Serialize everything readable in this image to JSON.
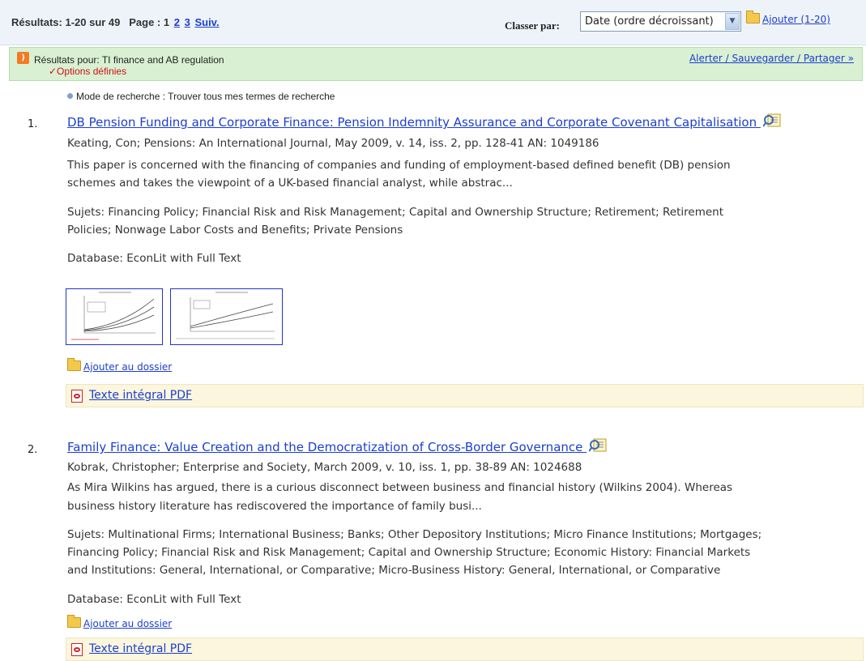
{
  "header": {
    "results_summary": "Résultats: 1-20 sur 49",
    "page_label": "Page : 1",
    "page_links": [
      "2",
      "3"
    ],
    "next_label": "Suiv.",
    "sort_label": "Classer par:",
    "sort_value": "Date (ordre décroissant)",
    "add_label": "Ajouter (1-20)"
  },
  "results_bar": {
    "query": "Résultats pour: TI finance and AB regulation",
    "options": "✓Options définies",
    "alert_link": "Alerter / Sauvegarder / Partager »"
  },
  "search_mode": "Mode de recherche : Trouver tous mes termes de recherche",
  "results": [
    {
      "number": "1.",
      "title": "DB Pension Funding and Corporate Finance: Pension Indemnity Assurance and Corporate Covenant Capitalisation",
      "citation": "Keating, Con; Pensions: An International Journal, May 2009, v. 14, iss. 2, pp. 128-41 AN: 1049186",
      "abstract_1": "This paper is concerned with the financing of companies and funding of employment-based defined benefit (DB) pension",
      "abstract_2": "schemes and takes the viewpoint of a UK-based financial analyst, while abstrac...",
      "subjects_1": "Sujets: Financing Policy; Financial Risk and Risk Management; Capital and Ownership Structure; Retirement; Retirement",
      "subjects_2": "Policies; Nonwage Labor Costs and Benefits; Private Pensions",
      "database": "Database: EconLit with Full Text",
      "add_folder": "Ajouter au dossier",
      "pdf": "Texte intégral PDF"
    },
    {
      "number": "2.",
      "title": "Family Finance: Value Creation and the Democratization of Cross-Border Governance",
      "citation": "Kobrak, Christopher; Enterprise and Society, March 2009, v. 10, iss. 1, pp. 38-89 AN: 1024688",
      "abstract_1": "As Mira Wilkins has argued, there is a curious disconnect between business and financial history (Wilkins 2004). Whereas",
      "abstract_2": "business history literature has rediscovered the importance of family busi...",
      "subjects_1": "Sujets: Multinational Firms; International Business; Banks; Other Depository Institutions; Micro Finance Institutions; Mortgages;",
      "subjects_2": "Financing Policy; Financial Risk and Risk Management; Capital and Ownership Structure; Economic History: Financial Markets",
      "subjects_3": "and Institutions: General, International, or Comparative; Micro-Business History: General, International, or Comparative",
      "database": "Database: EconLit with Full Text",
      "add_folder": "Ajouter au dossier",
      "pdf": "Texte intégral PDF"
    }
  ]
}
